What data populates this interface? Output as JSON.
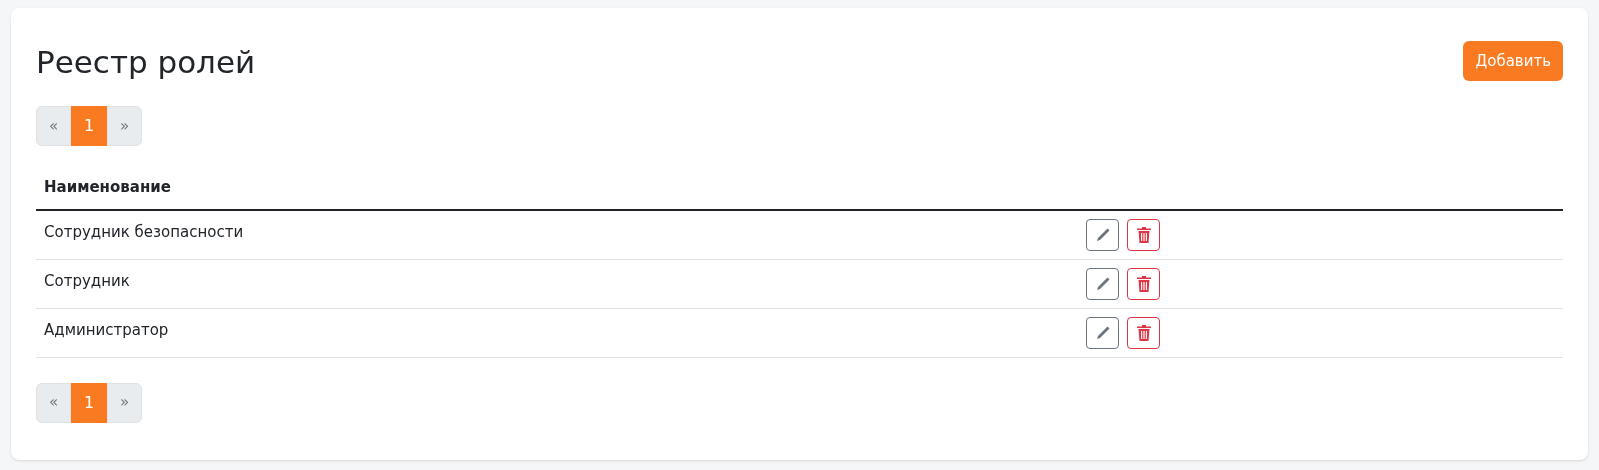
{
  "title": "Реестр ролей",
  "add_button": "Добавить",
  "pagination_top": {
    "prev": "«",
    "next": "»",
    "pages": [
      {
        "label": "1",
        "selected": true
      }
    ]
  },
  "table": {
    "columns": [
      "Наименование"
    ],
    "rows": [
      {
        "name": "Сотрудник безопасности"
      },
      {
        "name": "Сотрудник"
      },
      {
        "name": "Администратор"
      }
    ]
  },
  "pagination_bottom": {
    "prev": "«",
    "next": "»",
    "pages": [
      {
        "label": "1",
        "selected": true
      }
    ]
  }
}
